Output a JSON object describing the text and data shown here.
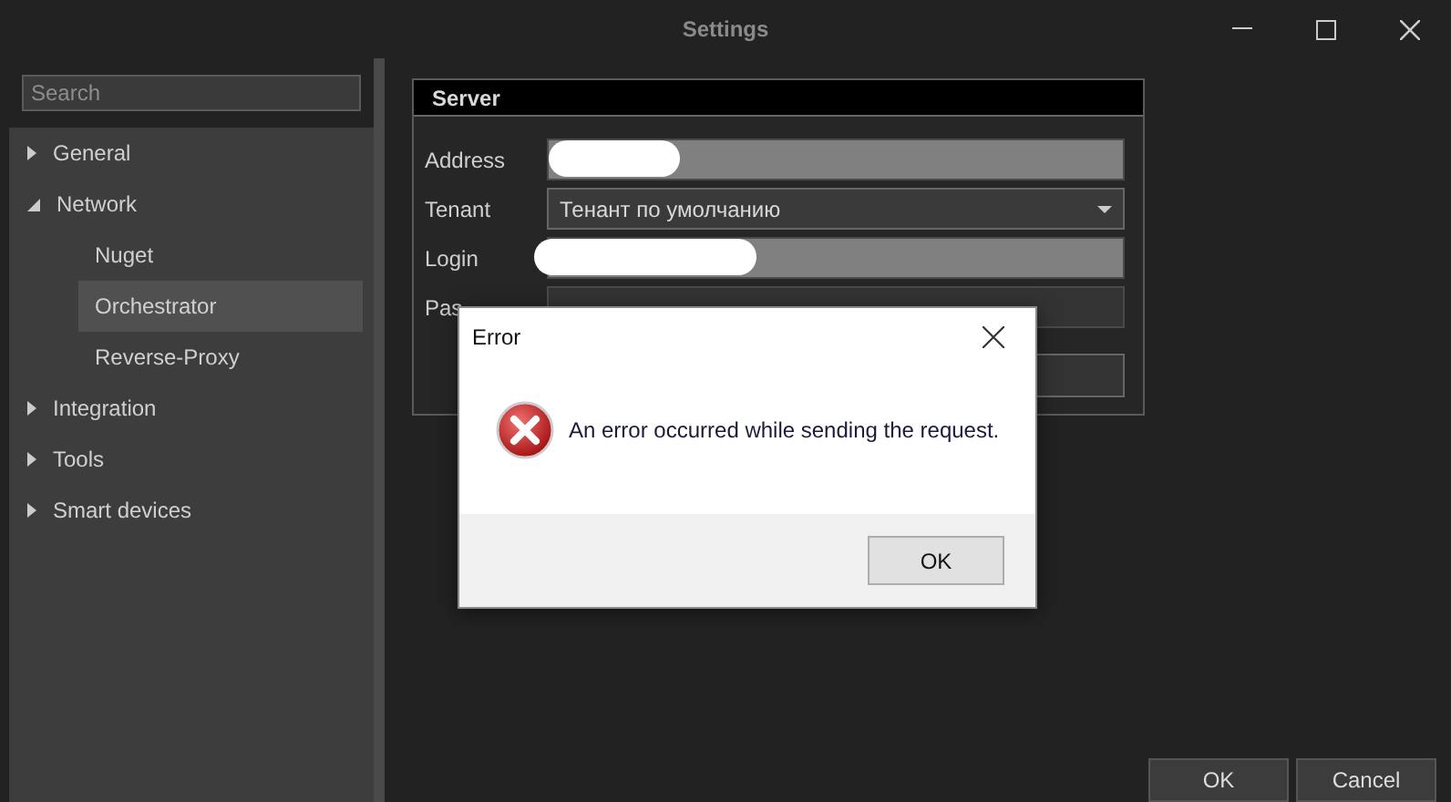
{
  "window": {
    "title": "Settings"
  },
  "sidebar": {
    "search": {
      "placeholder": "Search"
    },
    "tree": [
      {
        "label": "General",
        "expanded": false,
        "selected": false
      },
      {
        "label": "Network",
        "expanded": true,
        "selected": false,
        "children": [
          {
            "label": "Nuget",
            "selected": false
          },
          {
            "label": "Orchestrator",
            "selected": true
          },
          {
            "label": "Reverse-Proxy",
            "selected": false
          }
        ]
      },
      {
        "label": "Integration",
        "expanded": false,
        "selected": false
      },
      {
        "label": "Tools",
        "expanded": false,
        "selected": false
      },
      {
        "label": "Smart devices",
        "expanded": false,
        "selected": false
      }
    ]
  },
  "server": {
    "title": "Server",
    "fields": [
      {
        "label": "Address",
        "kind": "text",
        "redacted": true
      },
      {
        "label": "Tenant",
        "kind": "dropdown",
        "value": "Тенант по умолчанию"
      },
      {
        "label": "Login",
        "kind": "text",
        "redacted": true
      },
      {
        "label": "Pas",
        "kind": "password"
      }
    ]
  },
  "dialog": {
    "title": "Error",
    "message": "An error occurred while sending the request.",
    "button": "OK"
  },
  "buttons": [
    "OK",
    "Cancel"
  ]
}
